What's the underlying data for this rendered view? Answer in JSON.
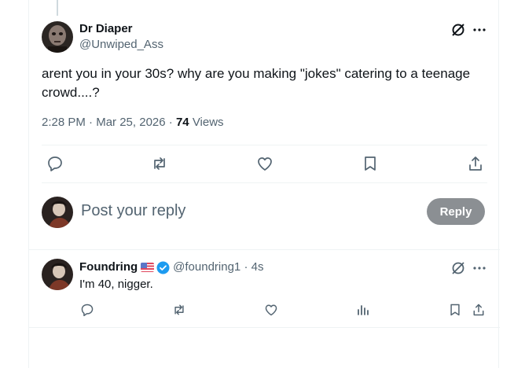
{
  "main_tweet": {
    "display_name": "Dr Diaper",
    "handle": "@Unwiped_Ass",
    "text": "arent you in your 30s? why are you making \"jokes\" catering to a teenage crowd....?",
    "time": "2:28 PM",
    "sep1": "·",
    "date": "Mar 25, 2026",
    "sep2": "·",
    "views_count": "74",
    "views_label": "Views"
  },
  "composer": {
    "placeholder": "Post your reply",
    "reply_button": "Reply"
  },
  "reply_tweet": {
    "display_name": "Foundring",
    "handle": "@foundring1",
    "sep": "·",
    "age": "4s",
    "text": "I'm 40, nigger."
  },
  "icons": {
    "grok": "grok-slash-icon",
    "more": "more-dots-icon",
    "reply": "reply-bubble-icon",
    "retweet": "retweet-icon",
    "like": "heart-icon",
    "bookmark": "bookmark-icon",
    "share": "share-upload-icon",
    "analytics": "analytics-bars-icon",
    "verified": "verified-badge-icon",
    "flag": "us-flag-icon"
  },
  "colors": {
    "text": "#0f1419",
    "muted": "#536471",
    "verified_blue": "#1d9bf0",
    "reply_button_bg": "#8b8f93",
    "divider": "#eff3f4"
  }
}
